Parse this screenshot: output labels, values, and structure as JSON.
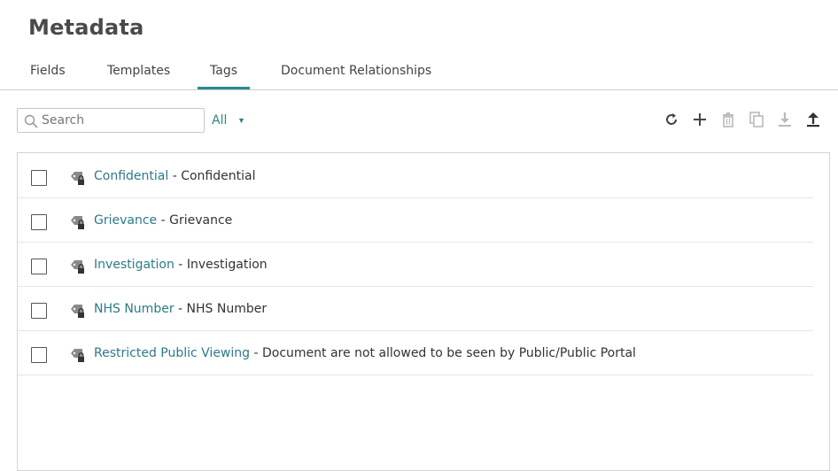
{
  "page": {
    "title": "Metadata"
  },
  "tabs": [
    {
      "label": "Fields",
      "active": false
    },
    {
      "label": "Templates",
      "active": false
    },
    {
      "label": "Tags",
      "active": true
    },
    {
      "label": "Document Relationships",
      "active": false
    }
  ],
  "search": {
    "placeholder": "Search",
    "value": ""
  },
  "filter": {
    "selected": "All",
    "caret": "▼"
  },
  "toolbar": {
    "icons": [
      "refresh-icon",
      "add-icon",
      "delete-icon",
      "copy-icon",
      "download-icon",
      "upload-icon"
    ]
  },
  "tags": [
    {
      "name": "Confidential",
      "separator": " - ",
      "description": "Confidential",
      "checked": false
    },
    {
      "name": "Grievance",
      "separator": " - ",
      "description": "Grievance",
      "checked": false
    },
    {
      "name": "Investigation",
      "separator": " - ",
      "description": "Investigation",
      "checked": false
    },
    {
      "name": "NHS Number",
      "separator": " - ",
      "description": "NHS Number",
      "checked": false
    },
    {
      "name": "Restricted Public Viewing",
      "separator": " - ",
      "description": "Document are not allowed to be seen by Public/Public Portal",
      "checked": false
    }
  ],
  "colors": {
    "accent": "#2a8a8a",
    "link": "#2b7a8a",
    "disabled": "#bbbbbb",
    "text": "#333333"
  }
}
